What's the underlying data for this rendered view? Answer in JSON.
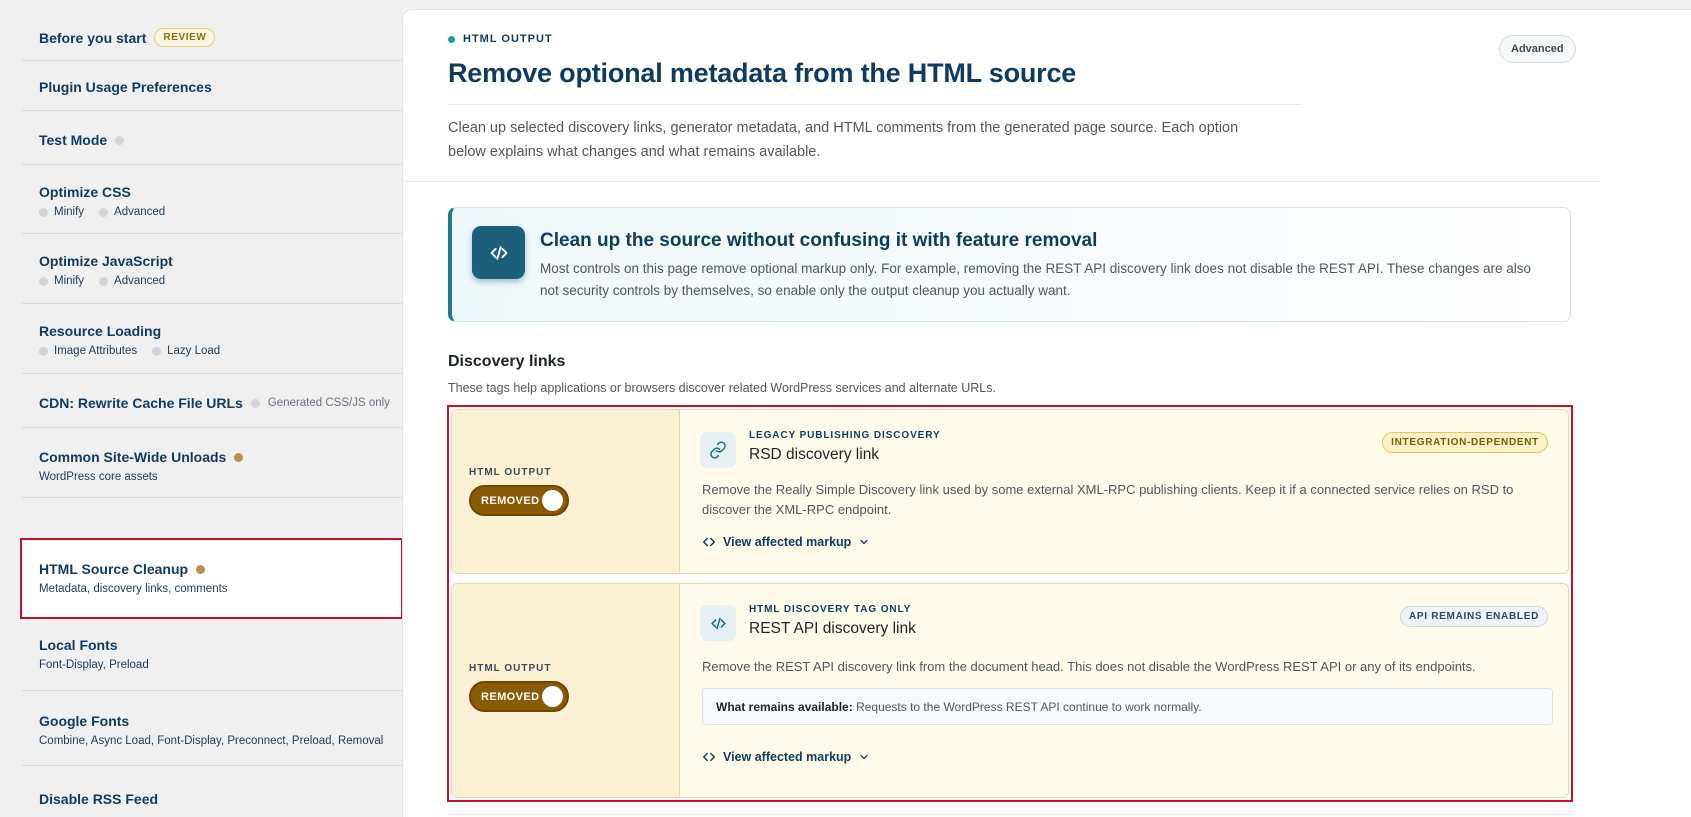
{
  "sidebar": {
    "items": [
      {
        "label": "Before you start",
        "badge": "REVIEW"
      },
      {
        "label": "Plugin Usage Preferences"
      },
      {
        "label": "Test Mode"
      },
      {
        "label": "Optimize CSS",
        "sub": [
          "Minify",
          "Advanced"
        ]
      },
      {
        "label": "Optimize JavaScript",
        "sub": [
          "Minify",
          "Advanced"
        ]
      },
      {
        "label": "Resource Loading",
        "sub": [
          "Image Attributes",
          "Lazy Load"
        ]
      },
      {
        "label": "CDN: Rewrite Cache File URLs",
        "note": "Generated CSS/JS only"
      },
      {
        "label": "Common Site-Wide Unloads",
        "sub_text": "WordPress core assets"
      },
      {
        "label": "HTML Source Cleanup",
        "sub_text": "Metadata, discovery links, comments"
      },
      {
        "label": "Local Fonts",
        "sub_text": "Font-Display, Preload"
      },
      {
        "label": "Google Fonts",
        "sub_text": "Combine, Async Load, Font-Display, Preconnect, Preload, Removal"
      },
      {
        "label": "Disable RSS Feed"
      }
    ]
  },
  "main": {
    "eyebrow": "HTML OUTPUT",
    "title": "Remove optional metadata from the HTML source",
    "intro": "Clean up selected discovery links, generator metadata, and HTML comments from the generated page source. Each option below explains what changes and what remains available.",
    "mode_pill": "Advanced",
    "callout": {
      "title": "Clean up the source without confusing it with feature removal",
      "text": "Most controls on this page remove optional markup only. For example, removing the REST API discovery link does not disable the REST API. These changes are also not security controls by themselves, so enable only the output cleanup you actually want."
    },
    "section": {
      "title": "Discovery links",
      "subtitle": "These tags help applications or browsers discover related WordPress services and alternate URLs."
    },
    "rows": [
      {
        "left_label": "HTML OUTPUT",
        "toggle_label": "REMOVED",
        "eyebrow": "LEGACY PUBLISHING DISCOVERY",
        "title": "RSD discovery link",
        "badge": "INTEGRATION-DEPENDENT",
        "description": "Remove the Really Simple Discovery link used by some external XML-RPC publishing clients. Keep it if a connected service relies on RSD to discover the XML-RPC endpoint.",
        "link": "View affected markup"
      },
      {
        "left_label": "HTML OUTPUT",
        "toggle_label": "REMOVED",
        "eyebrow": "HTML DISCOVERY TAG ONLY",
        "title": "REST API discovery link",
        "badge": "API REMAINS ENABLED",
        "description": "Remove the REST API discovery link from the document head. This does not disable the WordPress REST API or any of its endpoints.",
        "remains_label": "What remains available:",
        "remains_text": "Requests to the WordPress REST API continue to work normally.",
        "link": "View affected markup"
      }
    ]
  }
}
